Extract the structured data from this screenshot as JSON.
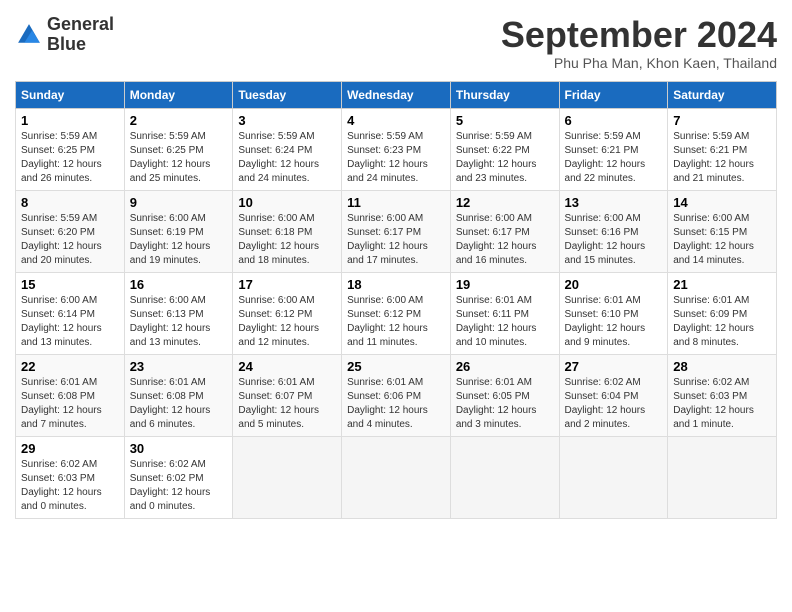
{
  "logo": {
    "line1": "General",
    "line2": "Blue"
  },
  "title": "September 2024",
  "location": "Phu Pha Man, Khon Kaen, Thailand",
  "days_of_week": [
    "Sunday",
    "Monday",
    "Tuesday",
    "Wednesday",
    "Thursday",
    "Friday",
    "Saturday"
  ],
  "weeks": [
    [
      {
        "day": "1",
        "sunrise": "5:59 AM",
        "sunset": "6:25 PM",
        "daylight": "12 hours and 26 minutes."
      },
      {
        "day": "2",
        "sunrise": "5:59 AM",
        "sunset": "6:25 PM",
        "daylight": "12 hours and 25 minutes."
      },
      {
        "day": "3",
        "sunrise": "5:59 AM",
        "sunset": "6:24 PM",
        "daylight": "12 hours and 24 minutes."
      },
      {
        "day": "4",
        "sunrise": "5:59 AM",
        "sunset": "6:23 PM",
        "daylight": "12 hours and 24 minutes."
      },
      {
        "day": "5",
        "sunrise": "5:59 AM",
        "sunset": "6:22 PM",
        "daylight": "12 hours and 23 minutes."
      },
      {
        "day": "6",
        "sunrise": "5:59 AM",
        "sunset": "6:21 PM",
        "daylight": "12 hours and 22 minutes."
      },
      {
        "day": "7",
        "sunrise": "5:59 AM",
        "sunset": "6:21 PM",
        "daylight": "12 hours and 21 minutes."
      }
    ],
    [
      {
        "day": "8",
        "sunrise": "5:59 AM",
        "sunset": "6:20 PM",
        "daylight": "12 hours and 20 minutes."
      },
      {
        "day": "9",
        "sunrise": "6:00 AM",
        "sunset": "6:19 PM",
        "daylight": "12 hours and 19 minutes."
      },
      {
        "day": "10",
        "sunrise": "6:00 AM",
        "sunset": "6:18 PM",
        "daylight": "12 hours and 18 minutes."
      },
      {
        "day": "11",
        "sunrise": "6:00 AM",
        "sunset": "6:17 PM",
        "daylight": "12 hours and 17 minutes."
      },
      {
        "day": "12",
        "sunrise": "6:00 AM",
        "sunset": "6:17 PM",
        "daylight": "12 hours and 16 minutes."
      },
      {
        "day": "13",
        "sunrise": "6:00 AM",
        "sunset": "6:16 PM",
        "daylight": "12 hours and 15 minutes."
      },
      {
        "day": "14",
        "sunrise": "6:00 AM",
        "sunset": "6:15 PM",
        "daylight": "12 hours and 14 minutes."
      }
    ],
    [
      {
        "day": "15",
        "sunrise": "6:00 AM",
        "sunset": "6:14 PM",
        "daylight": "12 hours and 13 minutes."
      },
      {
        "day": "16",
        "sunrise": "6:00 AM",
        "sunset": "6:13 PM",
        "daylight": "12 hours and 13 minutes."
      },
      {
        "day": "17",
        "sunrise": "6:00 AM",
        "sunset": "6:12 PM",
        "daylight": "12 hours and 12 minutes."
      },
      {
        "day": "18",
        "sunrise": "6:00 AM",
        "sunset": "6:12 PM",
        "daylight": "12 hours and 11 minutes."
      },
      {
        "day": "19",
        "sunrise": "6:01 AM",
        "sunset": "6:11 PM",
        "daylight": "12 hours and 10 minutes."
      },
      {
        "day": "20",
        "sunrise": "6:01 AM",
        "sunset": "6:10 PM",
        "daylight": "12 hours and 9 minutes."
      },
      {
        "day": "21",
        "sunrise": "6:01 AM",
        "sunset": "6:09 PM",
        "daylight": "12 hours and 8 minutes."
      }
    ],
    [
      {
        "day": "22",
        "sunrise": "6:01 AM",
        "sunset": "6:08 PM",
        "daylight": "12 hours and 7 minutes."
      },
      {
        "day": "23",
        "sunrise": "6:01 AM",
        "sunset": "6:08 PM",
        "daylight": "12 hours and 6 minutes."
      },
      {
        "day": "24",
        "sunrise": "6:01 AM",
        "sunset": "6:07 PM",
        "daylight": "12 hours and 5 minutes."
      },
      {
        "day": "25",
        "sunrise": "6:01 AM",
        "sunset": "6:06 PM",
        "daylight": "12 hours and 4 minutes."
      },
      {
        "day": "26",
        "sunrise": "6:01 AM",
        "sunset": "6:05 PM",
        "daylight": "12 hours and 3 minutes."
      },
      {
        "day": "27",
        "sunrise": "6:02 AM",
        "sunset": "6:04 PM",
        "daylight": "12 hours and 2 minutes."
      },
      {
        "day": "28",
        "sunrise": "6:02 AM",
        "sunset": "6:03 PM",
        "daylight": "12 hours and 1 minute."
      }
    ],
    [
      {
        "day": "29",
        "sunrise": "6:02 AM",
        "sunset": "6:03 PM",
        "daylight": "12 hours and 0 minutes."
      },
      {
        "day": "30",
        "sunrise": "6:02 AM",
        "sunset": "6:02 PM",
        "daylight": "12 hours and 0 minutes."
      },
      null,
      null,
      null,
      null,
      null
    ]
  ]
}
